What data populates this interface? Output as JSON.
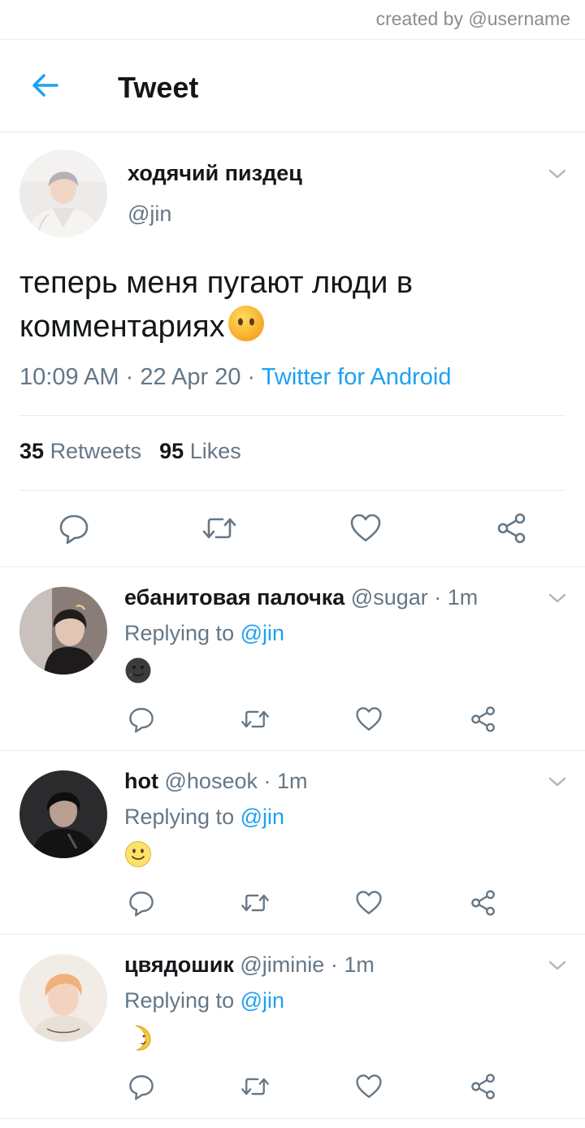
{
  "creator_credit": "created by @username",
  "header": {
    "title": "Tweet"
  },
  "tweet": {
    "name": "ходячий пиздец",
    "handle": "@jin",
    "text": "теперь меня пугают люди в комментариях",
    "time": "10:09 AM",
    "dot": "·",
    "date": "22 Apr 20",
    "source": "Twitter for Android",
    "retweets_count": "35",
    "retweets_label": "Retweets",
    "likes_count": "95",
    "likes_label": "Likes",
    "emoji": "neutral-face-without-mouth"
  },
  "replying_to_label": "Replying to",
  "replies": [
    {
      "name": "ебанитовая палочка",
      "handle": "@sugar",
      "time": "1m",
      "replying_to": "@jin",
      "emoji": "new-moon-face"
    },
    {
      "name": "hot",
      "handle": "@hoseok",
      "time": "1m",
      "replying_to": "@jin",
      "emoji": "slightly-smiling-face"
    },
    {
      "name": "цвядошик",
      "handle": "@jiminie",
      "time": "1m",
      "replying_to": "@jin",
      "emoji": "crescent-moon-face"
    }
  ],
  "icons": {
    "back": "arrow-left-icon",
    "more": "chevron-down-icon",
    "reply": "speech-bubble-icon",
    "retweet": "retweet-icon",
    "like": "heart-icon",
    "share": "share-icon"
  },
  "colors": {
    "accent": "#1da1f2",
    "muted": "#657786",
    "divider": "#e6ecf0",
    "text": "#14171a"
  }
}
